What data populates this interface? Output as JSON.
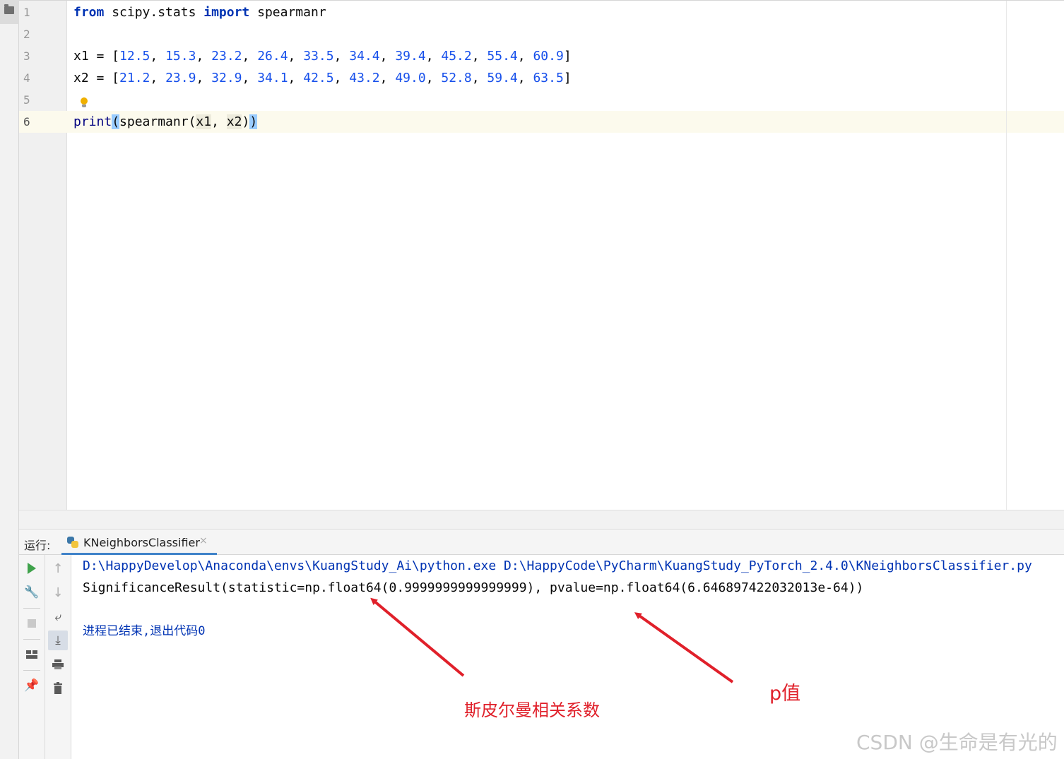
{
  "editor": {
    "line_numbers": [
      "1",
      "2",
      "3",
      "4",
      "5",
      "6"
    ],
    "code": {
      "l1": {
        "kw_from": "from",
        "module": " scipy.stats ",
        "kw_import": "import",
        "name": " spearmanr"
      },
      "l3": {
        "var": "x1",
        "assign": " = [",
        "values": [
          "12.5",
          "15.3",
          "23.2",
          "26.4",
          "33.5",
          "34.4",
          "39.4",
          "45.2",
          "55.4",
          "60.9"
        ],
        "close": "]"
      },
      "l4": {
        "var": "x2",
        "assign": " = [",
        "values": [
          "21.2",
          "23.9",
          "32.9",
          "34.1",
          "42.5",
          "43.2",
          "49.0",
          "52.8",
          "59.4",
          "63.5"
        ],
        "close": "]"
      },
      "l6": {
        "print": "print",
        "open": "(",
        "call": "spearmanr(",
        "arg1": "x1",
        "comma": ", ",
        "arg2": "x2",
        "inner_close": ")",
        "close": ")"
      }
    }
  },
  "run_panel": {
    "label": "运行:",
    "tab_label": "KNeighborsClassifier",
    "tab_close": "×",
    "console": {
      "command_line": "D:\\HappyDevelop\\Anaconda\\envs\\KuangStudy_Ai\\python.exe D:\\HappyCode\\PyCharm\\KuangStudy_PyTorch_2.4.0\\KNeighborsClassifier.py",
      "result_line": "SignificanceResult(statistic=np.float64(0.9999999999999999), pvalue=np.float64(6.646897422032013e-64))",
      "exit_line": "进程已结束,退出代码0"
    },
    "toolbar_icons": [
      "play-icon",
      "wrench-icon",
      "stop-icon",
      "layout-icon",
      "pin-icon",
      "arrow-up-icon",
      "arrow-down-icon",
      "soft-wrap-icon",
      "scroll-to-end-icon",
      "print-icon",
      "trash-icon"
    ]
  },
  "annotations": {
    "spearman_label": "斯皮尔曼相关系数",
    "pvalue_label": "p值",
    "color": "#e0202a"
  },
  "watermark": "CSDN @生命是有光的"
}
